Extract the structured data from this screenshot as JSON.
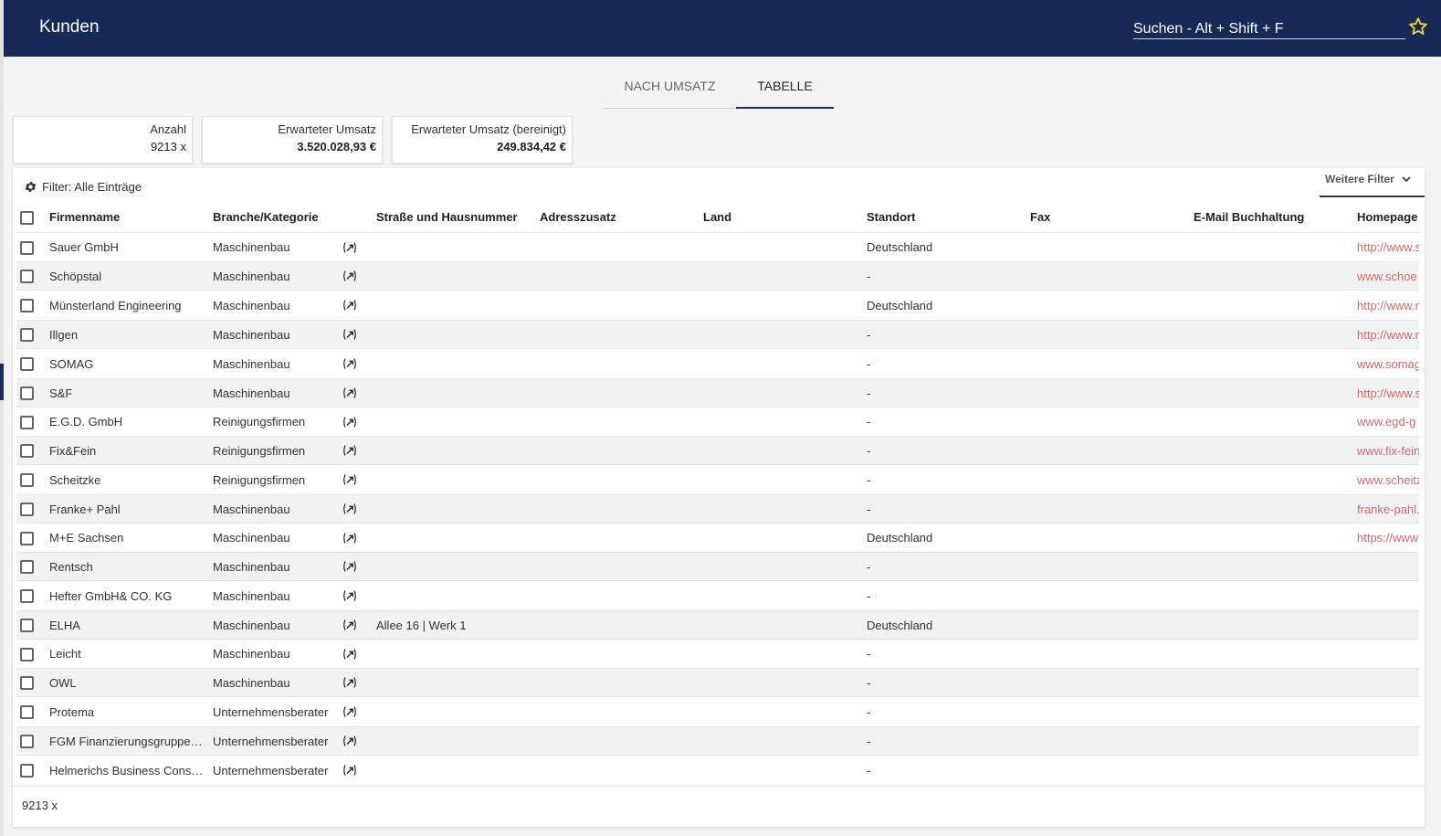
{
  "header": {
    "title": "Kunden",
    "search_placeholder": "Suchen - Alt + Shift + F",
    "accent_color": "#172a57",
    "star_icon": "star-icon"
  },
  "tabs": [
    {
      "label": "NACH UMSATZ",
      "active": false
    },
    {
      "label": "TABELLE",
      "active": true
    }
  ],
  "stats": [
    {
      "label": "Anzahl",
      "value": "9213 x"
    },
    {
      "label": "Erwarteter Umsatz",
      "value": "3.520.028,93 €"
    },
    {
      "label": "Erwarteter Umsatz (bereinigt)",
      "value": "249.834,42 €"
    }
  ],
  "filter": {
    "label": "Filter: Alle Einträge",
    "more_filters": "Weitere Filter"
  },
  "table": {
    "columns": [
      "Firmenname",
      "Branche/Kategorie",
      "Straße und Hausnummer",
      "Adresszusatz",
      "Land",
      "Standort",
      "Fax",
      "E-Mail Buchhaltung",
      "Homepage"
    ],
    "rows": [
      {
        "name": "Sauer GmbH",
        "branche": "Maschinenbau",
        "strasse": "",
        "standort": "Deutschland",
        "homepage": "http://www.s"
      },
      {
        "name": "Schöpstal",
        "branche": "Maschinenbau",
        "strasse": "",
        "standort": "-",
        "homepage": "www.schoe"
      },
      {
        "name": "Münsterland Engineering",
        "branche": "Maschinenbau",
        "strasse": "",
        "standort": "Deutschland",
        "homepage": "http://www.r"
      },
      {
        "name": "Illgen",
        "branche": "Maschinenbau",
        "strasse": "",
        "standort": "-",
        "homepage": "http://www.r"
      },
      {
        "name": "SOMAG",
        "branche": "Maschinenbau",
        "strasse": "",
        "standort": "-",
        "homepage": "www.somag"
      },
      {
        "name": "S&F",
        "branche": "Maschinenbau",
        "strasse": "",
        "standort": "-",
        "homepage": "http://www.s"
      },
      {
        "name": "E.G.D. GmbH",
        "branche": "Reinigungsfirmen",
        "strasse": "",
        "standort": "-",
        "homepage": "www.egd-g"
      },
      {
        "name": "Fix&Fein",
        "branche": "Reinigungsfirmen",
        "strasse": "",
        "standort": "-",
        "homepage": "www.fix-fein"
      },
      {
        "name": "Scheitzke",
        "branche": "Reinigungsfirmen",
        "strasse": "",
        "standort": "-",
        "homepage": "www.scheitz"
      },
      {
        "name": "Franke+ Pahl",
        "branche": "Maschinenbau",
        "strasse": "",
        "standort": "-",
        "homepage": "franke-pahl."
      },
      {
        "name": "M+E Sachsen",
        "branche": "Maschinenbau",
        "strasse": "",
        "standort": "Deutschland",
        "homepage": "https://www"
      },
      {
        "name": "Rentsch",
        "branche": "Maschinenbau",
        "strasse": "",
        "standort": "-",
        "homepage": ""
      },
      {
        "name": "Hefter GmbH& CO. KG",
        "branche": "Maschinenbau",
        "strasse": "",
        "standort": "-",
        "homepage": ""
      },
      {
        "name": "ELHA",
        "branche": "Maschinenbau",
        "strasse": "Allee 16 | Werk 1",
        "standort": "Deutschland",
        "homepage": ""
      },
      {
        "name": "Leicht",
        "branche": "Maschinenbau",
        "strasse": "",
        "standort": "-",
        "homepage": ""
      },
      {
        "name": "OWL",
        "branche": "Maschinenbau",
        "strasse": "",
        "standort": "-",
        "homepage": ""
      },
      {
        "name": "Protema",
        "branche": "Unternehmensberater",
        "strasse": "",
        "standort": "-",
        "homepage": ""
      },
      {
        "name": "FGM Finanzierungsgruppe…",
        "branche": "Unternehmensberater",
        "strasse": "",
        "standort": "-",
        "homepage": ""
      },
      {
        "name": "Helmerichs Business Cons…",
        "branche": "Unternehmensberater",
        "strasse": "",
        "standort": "-",
        "homepage": ""
      }
    ]
  },
  "footer": {
    "count": "9213 x"
  }
}
